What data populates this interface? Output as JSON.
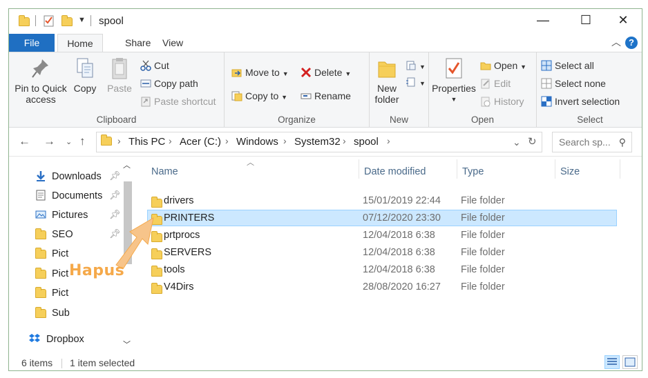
{
  "window": {
    "title": "spool",
    "controls": {
      "minimize": "—",
      "maximize": "☐",
      "close": "✕"
    }
  },
  "ribbon_tabs": [
    "File",
    "Home",
    "Share",
    "View"
  ],
  "ribbon": {
    "clipboard": {
      "label": "Clipboard",
      "pin_label": "Pin to Quick access",
      "copy_label": "Copy",
      "paste_label": "Paste",
      "cut_label": "Cut",
      "copy_path_label": "Copy path",
      "paste_shortcut_label": "Paste shortcut"
    },
    "organize": {
      "label": "Organize",
      "move_to_label": "Move to",
      "copy_to_label": "Copy to",
      "delete_label": "Delete",
      "rename_label": "Rename"
    },
    "new": {
      "label": "New",
      "new_folder_label": "New folder"
    },
    "open": {
      "label": "Open",
      "properties_label": "Properties",
      "open_label": "Open",
      "edit_label": "Edit",
      "history_label": "History"
    },
    "select": {
      "label": "Select",
      "select_all_label": "Select all",
      "select_none_label": "Select none",
      "invert_label": "Invert selection"
    }
  },
  "address": {
    "breadcrumbs": [
      "This PC",
      "Acer (C:)",
      "Windows",
      "System32",
      "spool"
    ],
    "search_placeholder": "Search sp..."
  },
  "nav_pane": {
    "items": [
      {
        "label": "Downloads",
        "pinned": true
      },
      {
        "label": "Documents",
        "pinned": true
      },
      {
        "label": "Pictures",
        "pinned": true
      },
      {
        "label": "SEO",
        "pinned": true
      },
      {
        "label": "Pict",
        "pinned": false
      },
      {
        "label": "Pict",
        "pinned": false
      },
      {
        "label": "Pict",
        "pinned": false
      },
      {
        "label": "Sub",
        "pinned": false
      },
      {
        "label": "Dropbox",
        "pinned": false
      }
    ]
  },
  "file_list": {
    "columns": [
      "Name",
      "Date modified",
      "Type",
      "Size"
    ],
    "rows": [
      {
        "name": "drivers",
        "date": "15/01/2019 22:44",
        "type": "File folder",
        "selected": false
      },
      {
        "name": "PRINTERS",
        "date": "07/12/2020 23:30",
        "type": "File folder",
        "selected": true
      },
      {
        "name": "prtprocs",
        "date": "12/04/2018 6:38",
        "type": "File folder",
        "selected": false
      },
      {
        "name": "SERVERS",
        "date": "12/04/2018 6:38",
        "type": "File folder",
        "selected": false
      },
      {
        "name": "tools",
        "date": "12/04/2018 6:38",
        "type": "File folder",
        "selected": false
      },
      {
        "name": "V4Dirs",
        "date": "28/08/2020 16:27",
        "type": "File folder",
        "selected": false
      }
    ]
  },
  "status": {
    "items_count": "6 items",
    "selected_count": "1 item selected"
  },
  "annotation": {
    "text": "Hapus",
    "color": "#f5a94a"
  },
  "colors": {
    "accent": "#1f6fc2",
    "selection": "#cce8ff",
    "folder": "#f6cf5a"
  }
}
